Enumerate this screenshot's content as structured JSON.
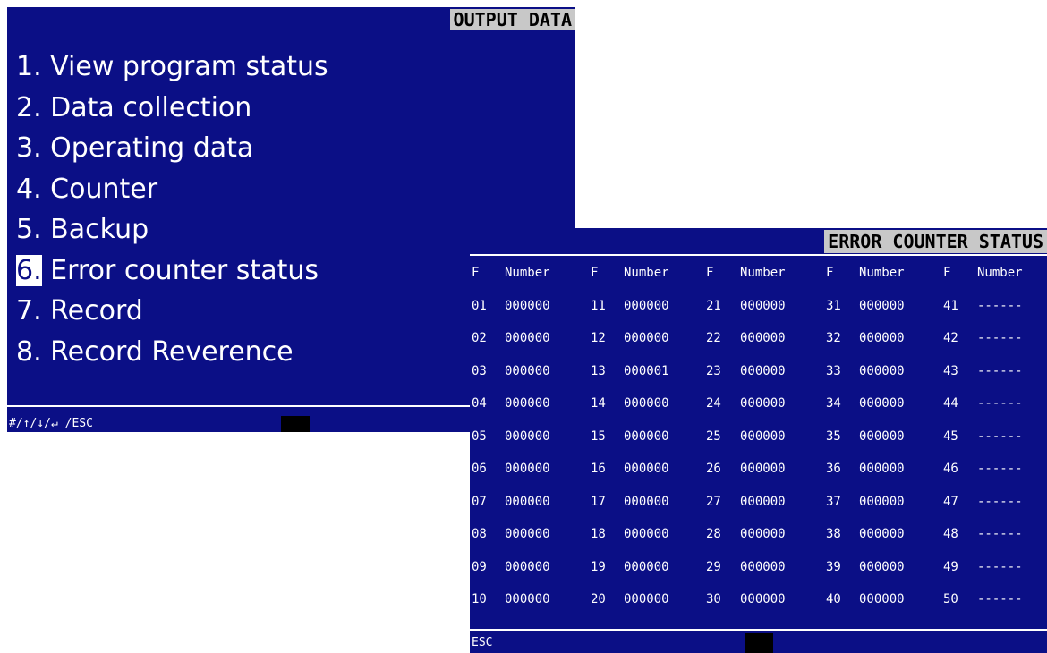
{
  "output_screen": {
    "title": "OUTPUT DATA",
    "menu": [
      {
        "num": "1.",
        "label": "View program status"
      },
      {
        "num": "2.",
        "label": "Data collection"
      },
      {
        "num": "3.",
        "label": "Operating data"
      },
      {
        "num": "4.",
        "label": "Counter"
      },
      {
        "num": "5.",
        "label": "Backup"
      },
      {
        "num": "6.",
        "label": "Error counter status",
        "selected": true
      },
      {
        "num": "7.",
        "label": "Record"
      },
      {
        "num": "8.",
        "label": "Record Reverence"
      }
    ],
    "footer_keys": "#/↑/↓/↵ /ESC"
  },
  "error_screen": {
    "title": "ERROR COUNTER STATUS",
    "header": [
      "F",
      "Number",
      "F",
      "Number",
      "F",
      "Number",
      "F",
      "Number",
      "F",
      "Number"
    ],
    "rows": [
      [
        "01",
        "000000",
        "11",
        "000000",
        "21",
        "000000",
        "31",
        "000000",
        "41",
        "------"
      ],
      [
        "02",
        "000000",
        "12",
        "000000",
        "22",
        "000000",
        "32",
        "000000",
        "42",
        "------"
      ],
      [
        "03",
        "000000",
        "13",
        "000001",
        "23",
        "000000",
        "33",
        "000000",
        "43",
        "------"
      ],
      [
        "04",
        "000000",
        "14",
        "000000",
        "24",
        "000000",
        "34",
        "000000",
        "44",
        "------"
      ],
      [
        "05",
        "000000",
        "15",
        "000000",
        "25",
        "000000",
        "35",
        "000000",
        "45",
        "------"
      ],
      [
        "06",
        "000000",
        "16",
        "000000",
        "26",
        "000000",
        "36",
        "000000",
        "46",
        "------"
      ],
      [
        "07",
        "000000",
        "17",
        "000000",
        "27",
        "000000",
        "37",
        "000000",
        "47",
        "------"
      ],
      [
        "08",
        "000000",
        "18",
        "000000",
        "28",
        "000000",
        "38",
        "000000",
        "48",
        "------"
      ],
      [
        "09",
        "000000",
        "19",
        "000000",
        "29",
        "000000",
        "39",
        "000000",
        "49",
        "------"
      ],
      [
        "10",
        "000000",
        "20",
        "000000",
        "30",
        "000000",
        "40",
        "000000",
        "50",
        "------"
      ]
    ],
    "footer_keys": "ESC"
  }
}
